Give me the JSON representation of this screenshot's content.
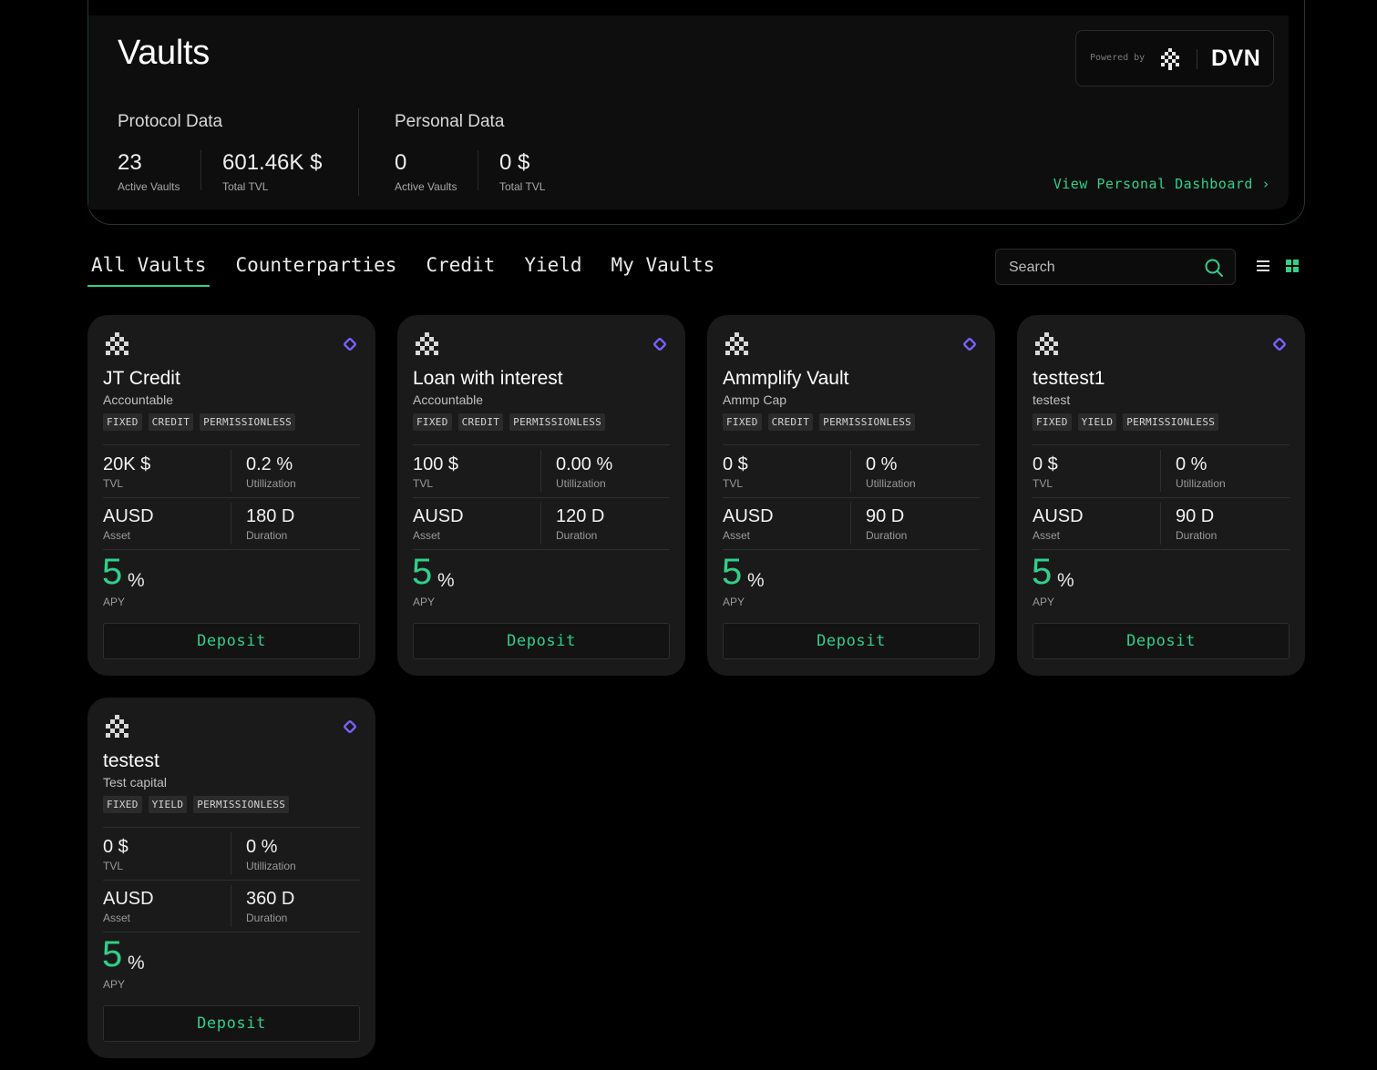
{
  "header": {
    "title": "Vaults",
    "protocol": {
      "label": "Protocol Data",
      "active_vaults": "23",
      "active_vaults_label": "Active Vaults",
      "total_tvl": "601.46K $",
      "total_tvl_label": "Total TVL"
    },
    "personal": {
      "label": "Personal Data",
      "active_vaults": "0",
      "active_vaults_label": "Active Vaults",
      "total_tvl": "0 $",
      "total_tvl_label": "Total TVL"
    },
    "powered_by": "Powered by",
    "brand": "DVN",
    "dashboard_link": "View Personal Dashboard ›"
  },
  "tabs": [
    {
      "label": "All Vaults",
      "active": true
    },
    {
      "label": "Counterparties"
    },
    {
      "label": "Credit"
    },
    {
      "label": "Yield"
    },
    {
      "label": "My Vaults"
    }
  ],
  "search": {
    "placeholder": "Search"
  },
  "colors": {
    "accent": "#2fd08a",
    "diamond": "#7b61ff",
    "card_bg": "#1a1a1a"
  },
  "icons": [
    "dvn-logo-icon",
    "search-icon",
    "list-view-icon",
    "grid-view-icon",
    "diamond-icon"
  ],
  "labels": {
    "tvl": "TVL",
    "utilization": "Utillization",
    "asset": "Asset",
    "duration": "Duration",
    "apy": "APY",
    "pct": "%",
    "deposit": "Deposit"
  },
  "vaults": [
    {
      "name": "JT Credit",
      "counterparty": "Accountable",
      "tags": [
        "FIXED",
        "CREDIT",
        "PERMISSIONLESS"
      ],
      "tvl": "20K $",
      "utilization": "0.2 %",
      "asset": "AUSD",
      "duration": "180 D",
      "apy": "5"
    },
    {
      "name": "Loan with interest",
      "counterparty": "Accountable",
      "tags": [
        "FIXED",
        "CREDIT",
        "PERMISSIONLESS"
      ],
      "tvl": "100 $",
      "utilization": "0.00 %",
      "asset": "AUSD",
      "duration": "120 D",
      "apy": "5"
    },
    {
      "name": "Ammplify Vault",
      "counterparty": "Ammp Cap",
      "tags": [
        "FIXED",
        "CREDIT",
        "PERMISSIONLESS"
      ],
      "tvl": "0 $",
      "utilization": "0 %",
      "asset": "AUSD",
      "duration": "90 D",
      "apy": "5"
    },
    {
      "name": "testtest1",
      "counterparty": "testest",
      "tags": [
        "FIXED",
        "YIELD",
        "PERMISSIONLESS"
      ],
      "tvl": "0 $",
      "utilization": "0 %",
      "asset": "AUSD",
      "duration": "90 D",
      "apy": "5"
    },
    {
      "name": "testest",
      "counterparty": "Test capital",
      "tags": [
        "FIXED",
        "YIELD",
        "PERMISSIONLESS"
      ],
      "tvl": "0 $",
      "utilization": "0 %",
      "asset": "AUSD",
      "duration": "360 D",
      "apy": "5"
    }
  ]
}
